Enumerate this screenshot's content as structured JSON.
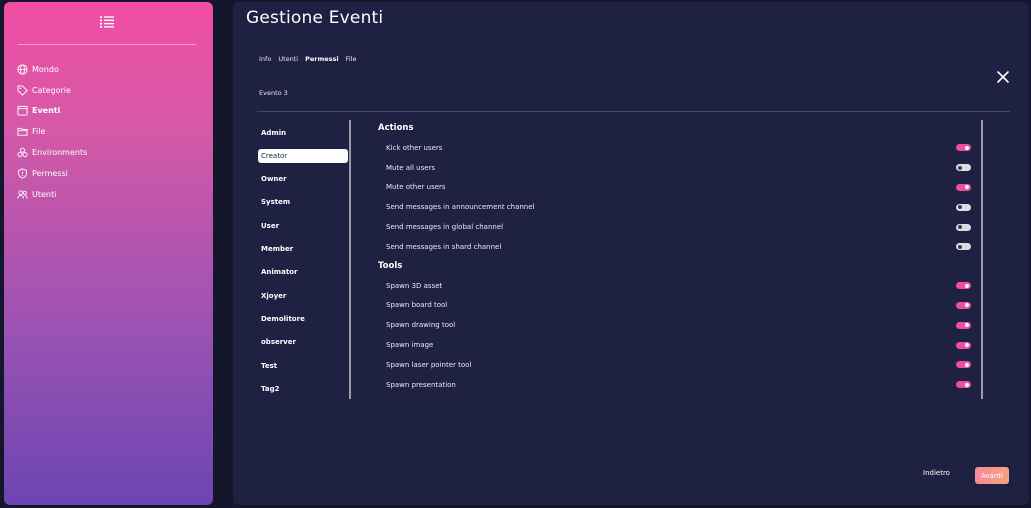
{
  "sidebar": {
    "items": [
      {
        "label": "Mondo",
        "icon": "globe-icon",
        "active": false
      },
      {
        "label": "Categorie",
        "icon": "tag-icon",
        "active": false
      },
      {
        "label": "Eventi",
        "icon": "calendar-icon",
        "active": true
      },
      {
        "label": "File",
        "icon": "folder-icon",
        "active": false
      },
      {
        "label": "Environments",
        "icon": "environments-icon",
        "active": false
      },
      {
        "label": "Permessi",
        "icon": "shield-icon",
        "active": false
      },
      {
        "label": "Utenti",
        "icon": "users-icon",
        "active": false
      }
    ]
  },
  "main": {
    "title": "Gestione Eventi",
    "tabs": [
      {
        "label": "Info",
        "active": false
      },
      {
        "label": "Utenti",
        "active": false
      },
      {
        "label": "Permessi",
        "active": true
      },
      {
        "label": "File",
        "active": false
      }
    ],
    "event_name": "Evento 3",
    "roles": [
      "Admin",
      "Creator",
      "Owner",
      "System",
      "User",
      "Member",
      "Animator",
      "Xjoyer",
      "Demolitore",
      "observer",
      "Test",
      "Tag2"
    ],
    "selected_role": "Creator",
    "sections": {
      "actions": {
        "title": "Actions",
        "items": [
          {
            "label": "Kick other users",
            "on": true
          },
          {
            "label": "Mute all users",
            "on": false
          },
          {
            "label": "Mute other users",
            "on": true
          },
          {
            "label": "Send messages in announcement channel",
            "on": false
          },
          {
            "label": "Send messages in global channel",
            "on": false
          },
          {
            "label": "Send messages in shard channel",
            "on": false
          }
        ]
      },
      "tools": {
        "title": "Tools",
        "items": [
          {
            "label": "Spawn 3D asset",
            "on": true
          },
          {
            "label": "Spawn board tool",
            "on": true
          },
          {
            "label": "Spawn drawing tool",
            "on": true
          },
          {
            "label": "Spawn image",
            "on": true
          },
          {
            "label": "Spawn laser pointer tool",
            "on": true
          },
          {
            "label": "Spawn presentation",
            "on": true
          }
        ]
      }
    },
    "footer": {
      "back_label": "Indietro",
      "next_label": "Avanti"
    }
  },
  "colors": {
    "accent": "#ef4e9c",
    "panel": "#1f2142",
    "background": "#14162b"
  }
}
